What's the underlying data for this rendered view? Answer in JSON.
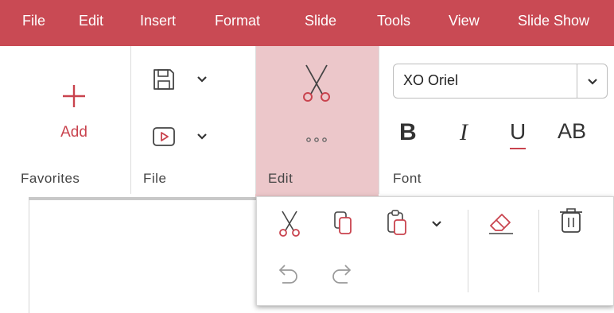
{
  "menubar": {
    "items": [
      "File",
      "Edit",
      "Insert",
      "Format",
      "Slide",
      "Tools",
      "View",
      "Slide Show"
    ]
  },
  "ribbon": {
    "favorites": {
      "label": "Favorites",
      "add_label": "Add",
      "add_icon": "plus-icon"
    },
    "file": {
      "label": "File",
      "save_icon": "save-icon",
      "present_icon": "play-icon"
    },
    "edit": {
      "label": "Edit",
      "cut_icon": "scissors-icon",
      "more_icon": "more-icon"
    },
    "font": {
      "label": "Font",
      "font_name": "XO Oriel",
      "bold": "B",
      "italic": "I",
      "underline": "U",
      "caps": "AB"
    }
  },
  "edit_panel": {
    "cut_icon": "scissors-icon",
    "copy_icon": "copy-icon",
    "paste_icon": "paste-icon",
    "clear_icon": "eraser-icon",
    "delete_icon": "trash-icon",
    "undo_icon": "undo-icon",
    "redo_icon": "redo-icon"
  },
  "colors": {
    "accent": "#c94a54",
    "edit_highlight": "#ecc7ca",
    "icon_red": "#c9434e"
  }
}
